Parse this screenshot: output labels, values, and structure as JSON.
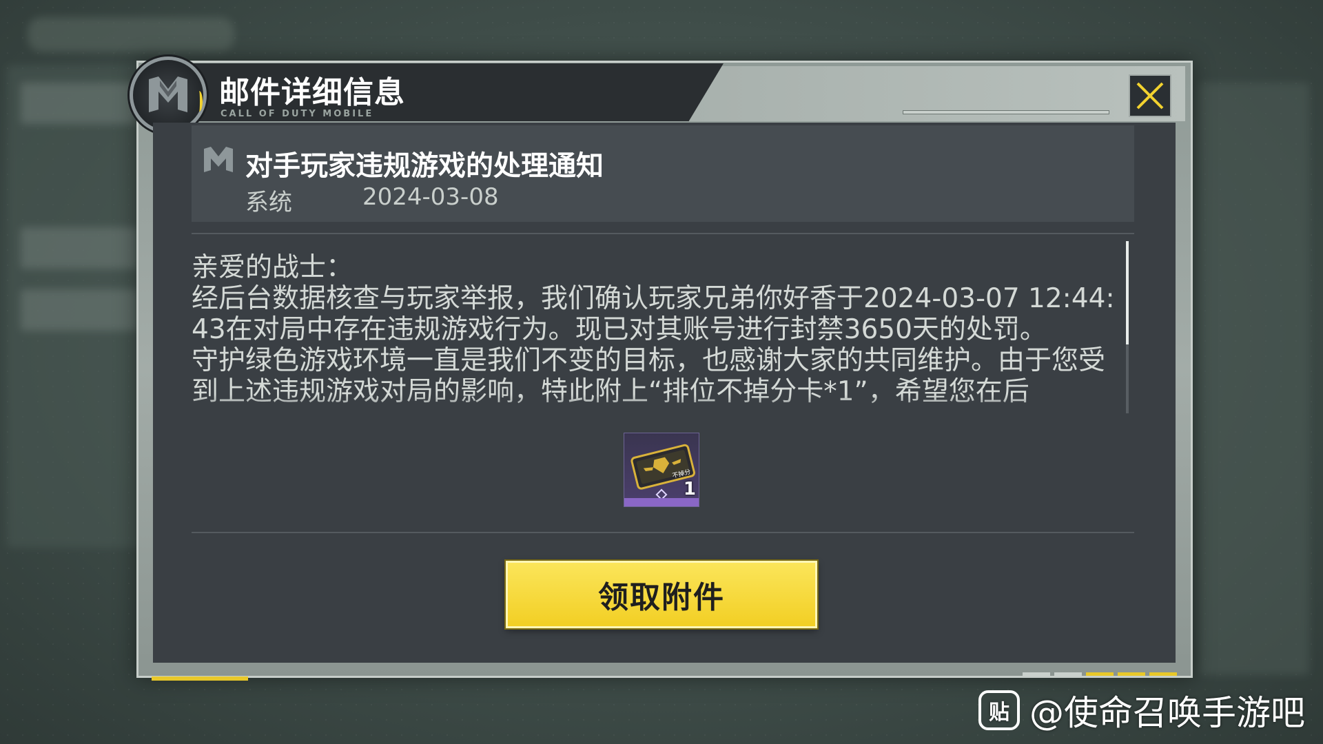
{
  "dialog": {
    "title": "邮件详细信息",
    "subtitle": "CALL OF DUTY MOBILE",
    "close_icon": "close-x-icon",
    "accent_color": "#f2d22f"
  },
  "mail": {
    "title": "对手玩家违规游戏的处理通知",
    "sender": "系统",
    "date": "2024-03-08",
    "body": [
      "亲爱的战士：",
      "经后台数据核查与玩家举报，我们确认玩家兄弟你好香于2024-03-07 12:44:43在对局中存在违规游戏行为。现已对其账号进行封禁3650天的处罚。",
      "守护绿色游戏环境一直是我们不变的目标，也感谢大家的共同维护。由于您受到上述违规游戏对局的影响，特此附上“排位不掉分卡*1”，希望您在后"
    ]
  },
  "attachment": {
    "icon": "rank-protection-card-icon",
    "card_label": "不掉分",
    "count": "1",
    "rarity_color": "#8a67c6"
  },
  "actions": {
    "claim_label": "领取附件"
  },
  "watermark": {
    "icon_glyph": "贴",
    "text": "@使命召唤手游吧"
  }
}
